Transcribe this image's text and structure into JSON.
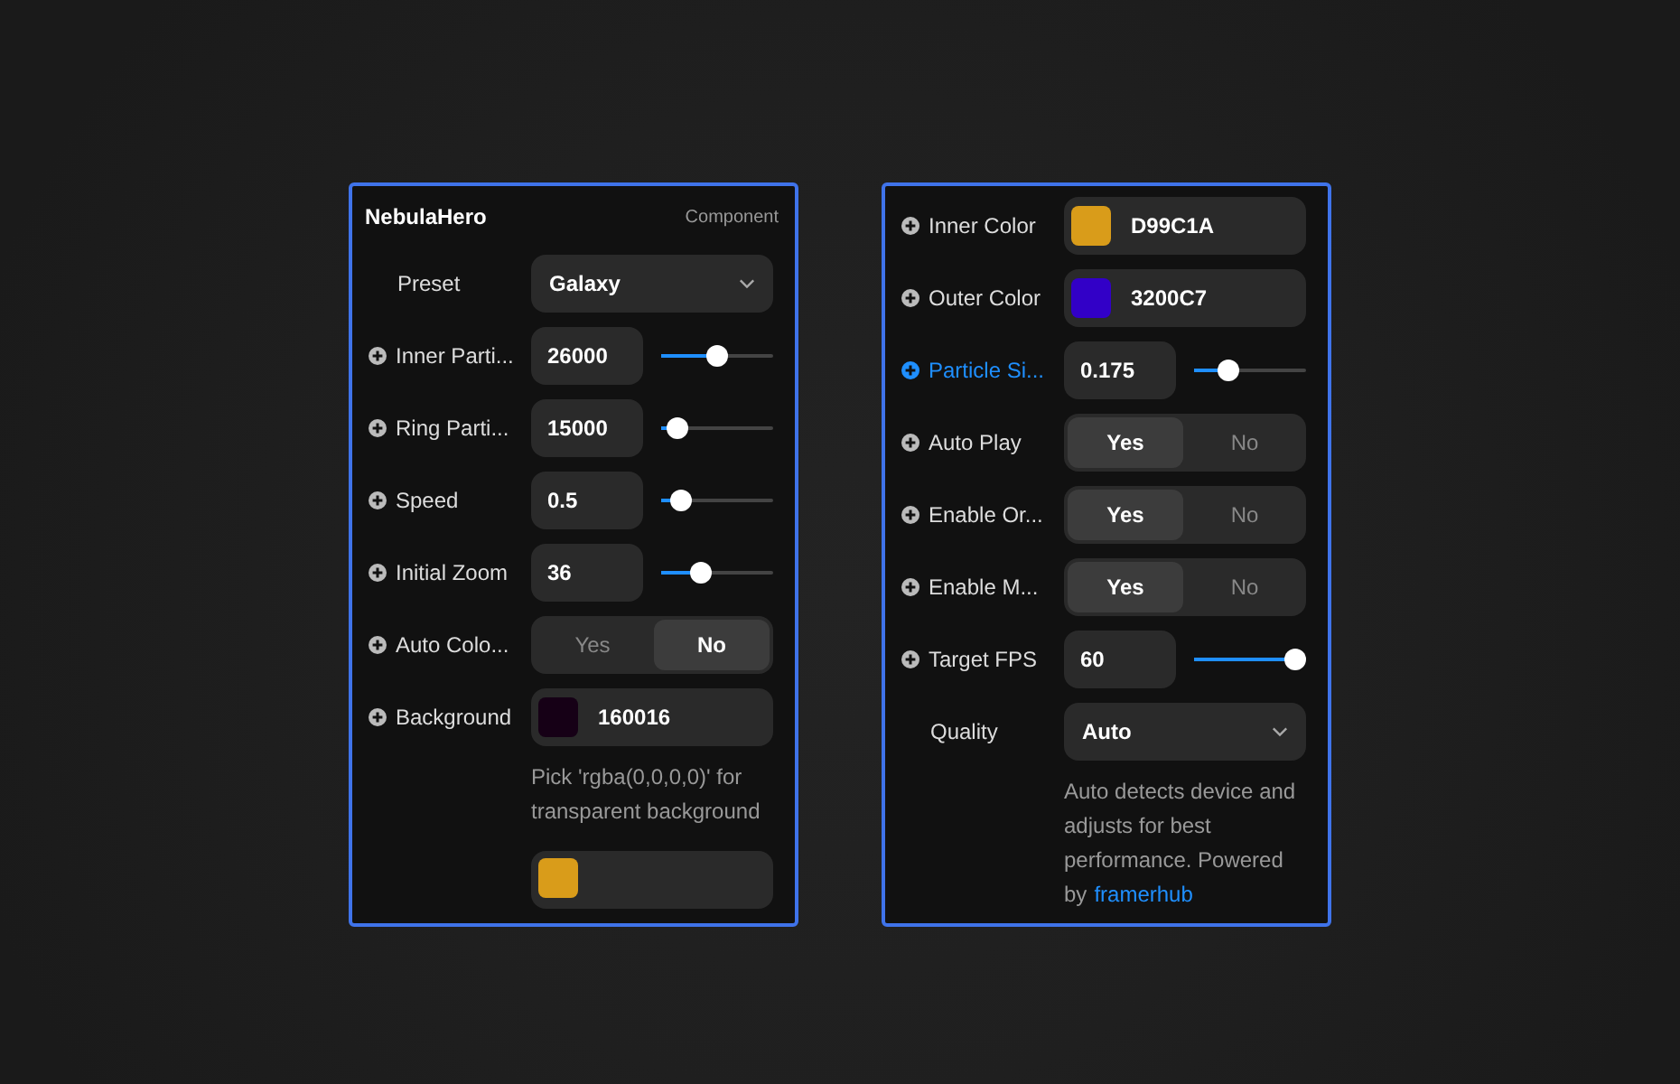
{
  "panels": [
    {
      "title": "NebulaHero",
      "subtitle": "Component",
      "rows": [
        {
          "kind": "select",
          "label": "Preset",
          "addable": false,
          "highlighted": false,
          "value": "Galaxy"
        },
        {
          "kind": "number",
          "label": "Inner Parti...",
          "addable": true,
          "highlighted": false,
          "value": "26000",
          "level": 0.5
        },
        {
          "kind": "number",
          "label": "Ring Parti...",
          "addable": true,
          "highlighted": false,
          "value": "15000",
          "level": 0.06
        },
        {
          "kind": "number",
          "label": "Speed",
          "addable": true,
          "highlighted": false,
          "value": "0.5",
          "level": 0.1
        },
        {
          "kind": "number",
          "label": "Initial Zoom",
          "addable": true,
          "highlighted": false,
          "value": "36",
          "level": 0.32
        },
        {
          "kind": "toggle",
          "label": "Auto Colo...",
          "addable": true,
          "highlighted": false,
          "options": [
            {
              "label": "Yes",
              "selected": false
            },
            {
              "label": "No",
              "selected": true
            }
          ]
        },
        {
          "kind": "color",
          "label": "Background",
          "addable": true,
          "highlighted": false,
          "value": "160016",
          "color": "#160016"
        },
        {
          "kind": "hint",
          "text": "Pick 'rgba(0,0,0,0)' for transparent background"
        },
        {
          "kind": "peek",
          "color": "#d99c1a"
        }
      ]
    },
    {
      "rows": [
        {
          "kind": "color",
          "label": "Inner Color",
          "addable": true,
          "highlighted": false,
          "value": "D99C1A",
          "color": "#d99c1a"
        },
        {
          "kind": "color",
          "label": "Outer Color",
          "addable": true,
          "highlighted": false,
          "value": "3200C7",
          "color": "#3200c7"
        },
        {
          "kind": "number",
          "label": "Particle Si...",
          "addable": true,
          "highlighted": true,
          "value": "0.175",
          "level": 0.26
        },
        {
          "kind": "toggle",
          "label": "Auto Play",
          "addable": true,
          "highlighted": false,
          "options": [
            {
              "label": "Yes",
              "selected": true
            },
            {
              "label": "No",
              "selected": false
            }
          ]
        },
        {
          "kind": "toggle",
          "label": "Enable Or...",
          "addable": true,
          "highlighted": false,
          "options": [
            {
              "label": "Yes",
              "selected": true
            },
            {
              "label": "No",
              "selected": false
            }
          ]
        },
        {
          "kind": "toggle",
          "label": "Enable M...",
          "addable": true,
          "highlighted": false,
          "options": [
            {
              "label": "Yes",
              "selected": true
            },
            {
              "label": "No",
              "selected": false
            }
          ]
        },
        {
          "kind": "number",
          "label": "Target FPS",
          "addable": true,
          "highlighted": false,
          "value": "60",
          "level": 1
        },
        {
          "kind": "select",
          "label": "Quality",
          "addable": false,
          "highlighted": false,
          "value": "Auto"
        },
        {
          "kind": "hint",
          "text": "Auto detects device and adjusts for best performance. Powered by",
          "link": "framerhub"
        }
      ]
    }
  ]
}
